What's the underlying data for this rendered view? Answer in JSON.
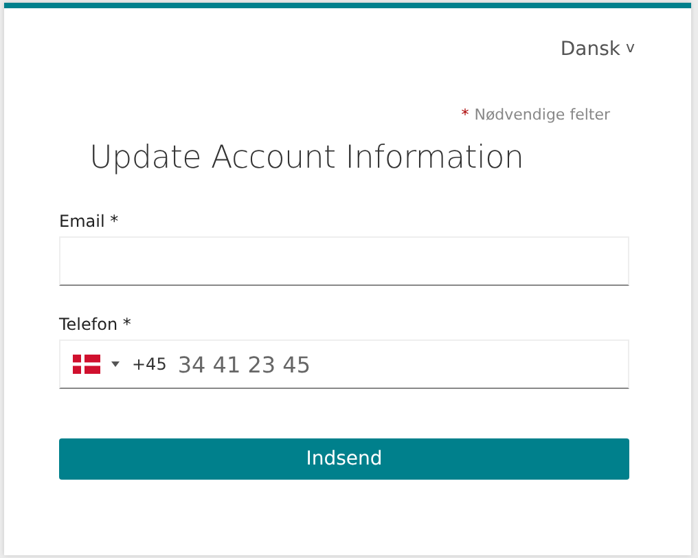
{
  "language": {
    "label": "Dansk",
    "caret": "v"
  },
  "required_note": {
    "mark": "*",
    "text": "Nødvendige felter"
  },
  "title": "Update Account Information",
  "fields": [
    {
      "kind": "email",
      "label": "Email *"
    },
    {
      "kind": "phone",
      "label": "Telefon *",
      "dial_code": "+45",
      "placeholder": "34 41 23 45"
    }
  ],
  "submit": "Indsend"
}
